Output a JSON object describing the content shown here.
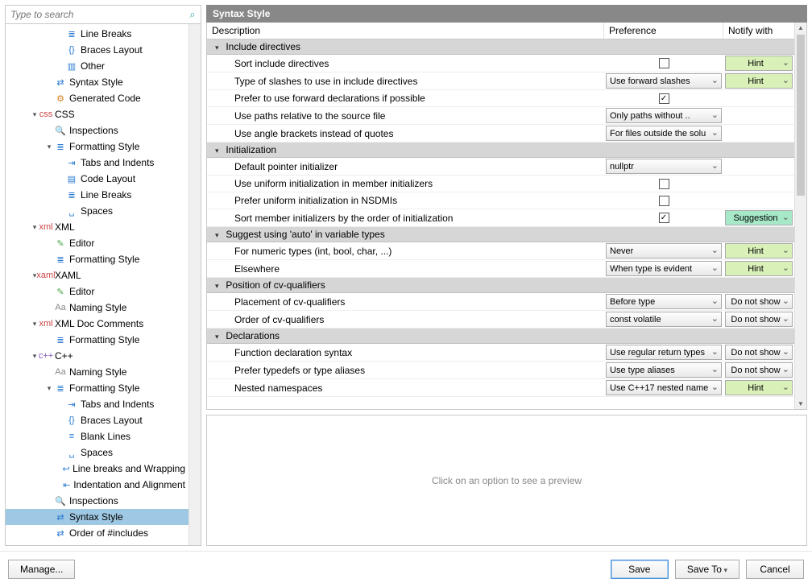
{
  "search": {
    "placeholder": "Type to search"
  },
  "title": "Syntax Style",
  "columns": {
    "description": "Description",
    "preference": "Preference",
    "notify": "Notify with"
  },
  "preview_hint": "Click on an option to see a preview",
  "footer": {
    "manage": "Manage...",
    "save": "Save",
    "save_to": "Save To",
    "cancel": "Cancel"
  },
  "tree": [
    {
      "indent": 62,
      "arrow": "",
      "icon": "≣",
      "iconcls": "ic-blue",
      "label": "Line Breaks"
    },
    {
      "indent": 62,
      "arrow": "",
      "icon": "{}",
      "iconcls": "ic-blue",
      "label": "Braces Layout"
    },
    {
      "indent": 62,
      "arrow": "",
      "icon": "▥",
      "iconcls": "ic-blue",
      "label": "Other"
    },
    {
      "indent": 48,
      "arrow": "",
      "icon": "⇄",
      "iconcls": "ic-blue",
      "label": "Syntax Style"
    },
    {
      "indent": 48,
      "arrow": "",
      "icon": "⚙",
      "iconcls": "ic-orange",
      "label": "Generated Code"
    },
    {
      "indent": 30,
      "arrow": "▾",
      "icon": "css",
      "iconcls": "ic-red",
      "label": "CSS"
    },
    {
      "indent": 48,
      "arrow": "",
      "icon": "🔍",
      "iconcls": "ic-gray",
      "label": "Inspections"
    },
    {
      "indent": 48,
      "arrow": "▾",
      "icon": "≣",
      "iconcls": "ic-blue",
      "label": "Formatting Style"
    },
    {
      "indent": 62,
      "arrow": "",
      "icon": "⇥",
      "iconcls": "ic-blue",
      "label": "Tabs and Indents"
    },
    {
      "indent": 62,
      "arrow": "",
      "icon": "▤",
      "iconcls": "ic-blue",
      "label": "Code Layout"
    },
    {
      "indent": 62,
      "arrow": "",
      "icon": "≣",
      "iconcls": "ic-blue",
      "label": "Line Breaks"
    },
    {
      "indent": 62,
      "arrow": "",
      "icon": "␣",
      "iconcls": "ic-blue",
      "label": "Spaces"
    },
    {
      "indent": 30,
      "arrow": "▾",
      "icon": "xml",
      "iconcls": "ic-red",
      "label": "XML"
    },
    {
      "indent": 48,
      "arrow": "",
      "icon": "✎",
      "iconcls": "ic-green",
      "label": "Editor"
    },
    {
      "indent": 48,
      "arrow": "",
      "icon": "≣",
      "iconcls": "ic-blue",
      "label": "Formatting Style"
    },
    {
      "indent": 30,
      "arrow": "▾",
      "icon": "xaml",
      "iconcls": "ic-red",
      "label": "XAML"
    },
    {
      "indent": 48,
      "arrow": "",
      "icon": "✎",
      "iconcls": "ic-green",
      "label": "Editor"
    },
    {
      "indent": 48,
      "arrow": "",
      "icon": "Aa",
      "iconcls": "ic-gray",
      "label": "Naming Style"
    },
    {
      "indent": 30,
      "arrow": "▾",
      "icon": "xml",
      "iconcls": "ic-red",
      "label": "XML Doc Comments"
    },
    {
      "indent": 48,
      "arrow": "",
      "icon": "≣",
      "iconcls": "ic-blue",
      "label": "Formatting Style"
    },
    {
      "indent": 30,
      "arrow": "▾",
      "icon": "c++",
      "iconcls": "ic-purple",
      "label": "C++"
    },
    {
      "indent": 48,
      "arrow": "",
      "icon": "Aa",
      "iconcls": "ic-gray",
      "label": "Naming Style"
    },
    {
      "indent": 48,
      "arrow": "▾",
      "icon": "≣",
      "iconcls": "ic-blue",
      "label": "Formatting Style"
    },
    {
      "indent": 62,
      "arrow": "",
      "icon": "⇥",
      "iconcls": "ic-blue",
      "label": "Tabs and Indents"
    },
    {
      "indent": 62,
      "arrow": "",
      "icon": "{}",
      "iconcls": "ic-blue",
      "label": "Braces Layout"
    },
    {
      "indent": 62,
      "arrow": "",
      "icon": "≡",
      "iconcls": "ic-blue",
      "label": "Blank Lines"
    },
    {
      "indent": 62,
      "arrow": "",
      "icon": "␣",
      "iconcls": "ic-blue",
      "label": "Spaces"
    },
    {
      "indent": 62,
      "arrow": "",
      "icon": "↩",
      "iconcls": "ic-blue",
      "label": "Line breaks and Wrapping"
    },
    {
      "indent": 62,
      "arrow": "",
      "icon": "⇤",
      "iconcls": "ic-blue",
      "label": "Indentation and Alignment"
    },
    {
      "indent": 48,
      "arrow": "",
      "icon": "🔍",
      "iconcls": "ic-gray",
      "label": "Inspections"
    },
    {
      "indent": 48,
      "arrow": "",
      "icon": "⇄",
      "iconcls": "ic-blue",
      "label": "Syntax Style",
      "selected": true
    },
    {
      "indent": 48,
      "arrow": "",
      "icon": "⇄",
      "iconcls": "ic-blue",
      "label": "Order of #includes"
    }
  ],
  "grid": [
    {
      "type": "group",
      "label": "Include directives"
    },
    {
      "type": "row",
      "desc": "Sort include directives",
      "pref_kind": "check",
      "checked": false,
      "notify": "Hint",
      "notifycls": "notify-hint"
    },
    {
      "type": "row",
      "desc": "Type of slashes to use in include directives",
      "pref_kind": "select",
      "pref": "Use forward slashes",
      "notify": "Hint",
      "notifycls": "notify-hint"
    },
    {
      "type": "row",
      "desc": "Prefer to use forward declarations if possible",
      "pref_kind": "check",
      "checked": true
    },
    {
      "type": "row",
      "desc": "Use paths relative to the source file",
      "pref_kind": "select",
      "pref": "Only paths without .."
    },
    {
      "type": "row",
      "desc": "Use angle brackets instead of quotes",
      "pref_kind": "select",
      "pref": "For files outside the solu"
    },
    {
      "type": "group",
      "label": "Initialization"
    },
    {
      "type": "row",
      "desc": "Default pointer initializer",
      "pref_kind": "select",
      "pref": "nullptr"
    },
    {
      "type": "row",
      "desc": "Use uniform initialization in member initializers",
      "pref_kind": "check",
      "checked": false
    },
    {
      "type": "row",
      "desc": "Prefer uniform initialization in NSDMIs",
      "pref_kind": "check",
      "checked": false
    },
    {
      "type": "row",
      "desc": "Sort member initializers by the order of initialization",
      "pref_kind": "check",
      "checked": true,
      "notify": "Suggestion",
      "notifycls": "notify-sugg"
    },
    {
      "type": "group",
      "label": "Suggest using 'auto' in variable types"
    },
    {
      "type": "row",
      "desc": "For numeric types (int, bool, char, ...)",
      "pref_kind": "select",
      "pref": "Never",
      "notify": "Hint",
      "notifycls": "notify-hint"
    },
    {
      "type": "row",
      "desc": "Elsewhere",
      "pref_kind": "select",
      "pref": "When type is evident",
      "notify": "Hint",
      "notifycls": "notify-hint"
    },
    {
      "type": "group",
      "label": "Position of cv-qualifiers"
    },
    {
      "type": "row",
      "desc": "Placement of cv-qualifiers",
      "pref_kind": "select",
      "pref": "Before type",
      "notify": "Do not show",
      "notifycls": "notify-dns"
    },
    {
      "type": "row",
      "desc": "Order of cv-qualifiers",
      "pref_kind": "select",
      "pref": "const volatile",
      "notify": "Do not show",
      "notifycls": "notify-dns"
    },
    {
      "type": "group",
      "label": "Declarations"
    },
    {
      "type": "row",
      "desc": "Function declaration syntax",
      "pref_kind": "select",
      "pref": "Use regular return types",
      "notify": "Do not show",
      "notifycls": "notify-dns"
    },
    {
      "type": "row",
      "desc": "Prefer typedefs or type aliases",
      "pref_kind": "select",
      "pref": "Use type aliases",
      "notify": "Do not show",
      "notifycls": "notify-dns"
    },
    {
      "type": "row",
      "desc": "Nested namespaces",
      "pref_kind": "select",
      "pref": "Use C++17 nested name",
      "notify": "Hint",
      "notifycls": "notify-hint"
    }
  ]
}
